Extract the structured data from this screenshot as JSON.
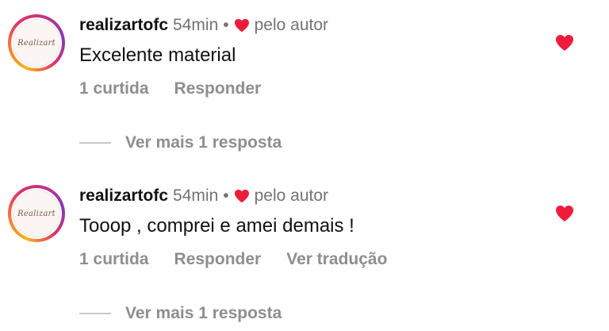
{
  "comments": [
    {
      "username": "realizartofc",
      "time": "54min",
      "separator": "•",
      "author_liked_label": "pelo autor",
      "avatar_text": "Realizart",
      "text": "Excelente material",
      "likes_label": "1 curtida",
      "reply_label": "Responder",
      "translate_label": "",
      "view_replies_label": "Ver mais 1 resposta"
    },
    {
      "username": "realizartofc",
      "time": "54min",
      "separator": "•",
      "author_liked_label": "pelo autor",
      "avatar_text": "Realizart",
      "text": "Tooop , comprei e amei demais !",
      "likes_label": "1 curtida",
      "reply_label": "Responder",
      "translate_label": "Ver tradução",
      "view_replies_label": "Ver mais 1 resposta"
    }
  ],
  "colors": {
    "heart": "#ed1c3a",
    "secondary_text": "#737373",
    "action_text": "#8e8e8e"
  },
  "icons": {
    "author_like": "heart-icon",
    "like": "heart-filled-icon"
  }
}
